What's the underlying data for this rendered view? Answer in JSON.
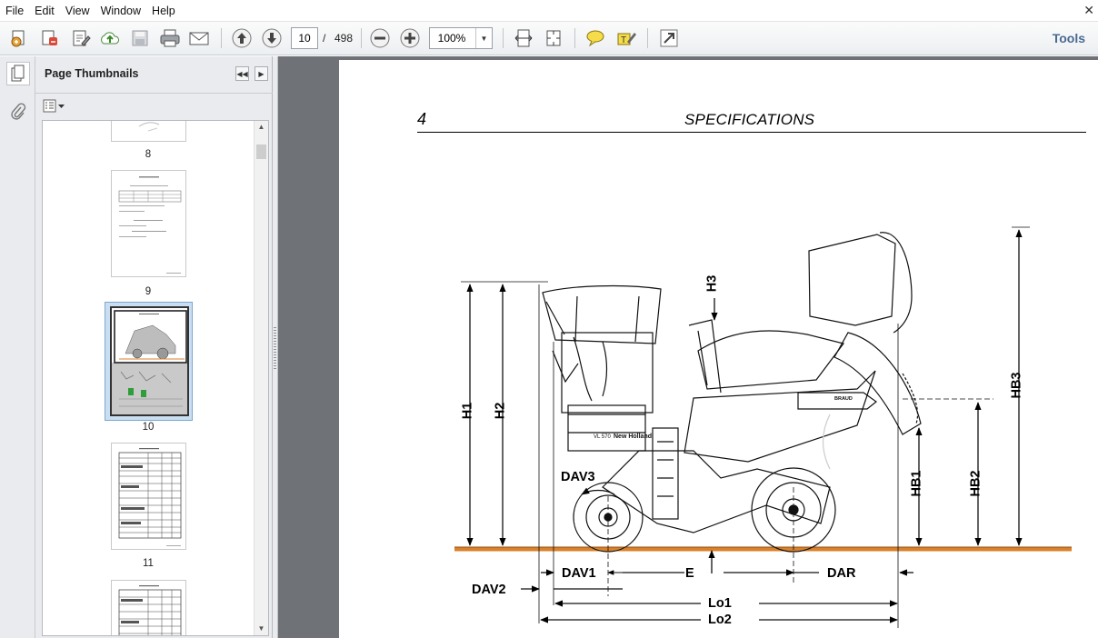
{
  "menubar": {
    "items": [
      "File",
      "Edit",
      "View",
      "Window",
      "Help"
    ],
    "close_glyph": "✕"
  },
  "toolbar": {
    "buttons": [
      "create-icon",
      "export-icon",
      "edit-icon",
      "upload-icon",
      "save-icon",
      "print-icon",
      "email-icon",
      "previous-page-icon",
      "next-page-icon",
      "zoom-out-icon",
      "zoom-in-icon",
      "fit-width-icon",
      "fit-page-icon",
      "comment-icon",
      "highlight-icon",
      "fullscreen-icon"
    ],
    "page_current": "10",
    "page_separator": "/",
    "page_total": "498",
    "zoom": "100%",
    "tools_label": "Tools"
  },
  "panel": {
    "title": "Page Thumbnails",
    "thumbnails": [
      {
        "label": "8"
      },
      {
        "label": "9"
      },
      {
        "label": "10",
        "selected": true
      },
      {
        "label": "11"
      },
      {
        "label": ""
      }
    ]
  },
  "document": {
    "page_number": "4",
    "section_title": "SPECIFICATIONS",
    "dimension_labels": {
      "H1": "H1",
      "H2": "H2",
      "H3": "H3",
      "HB1": "HB1",
      "HB2": "HB2",
      "HB3": "HB3",
      "DAV1": "DAV1",
      "DAV2": "DAV2",
      "DAV3": "DAV3",
      "E": "E",
      "DAR": "DAR",
      "Lo1": "Lo1",
      "Lo2": "Lo2"
    },
    "machine_text": {
      "brand": "New Holland",
      "model": "VL 570",
      "tank_label": "BRAUD"
    }
  },
  "colors": {
    "accent_tools": "#4a6a92",
    "ground_line": "#d9822b",
    "selected_thumb": "#c9dff1",
    "doc_background": "#6f7276"
  }
}
